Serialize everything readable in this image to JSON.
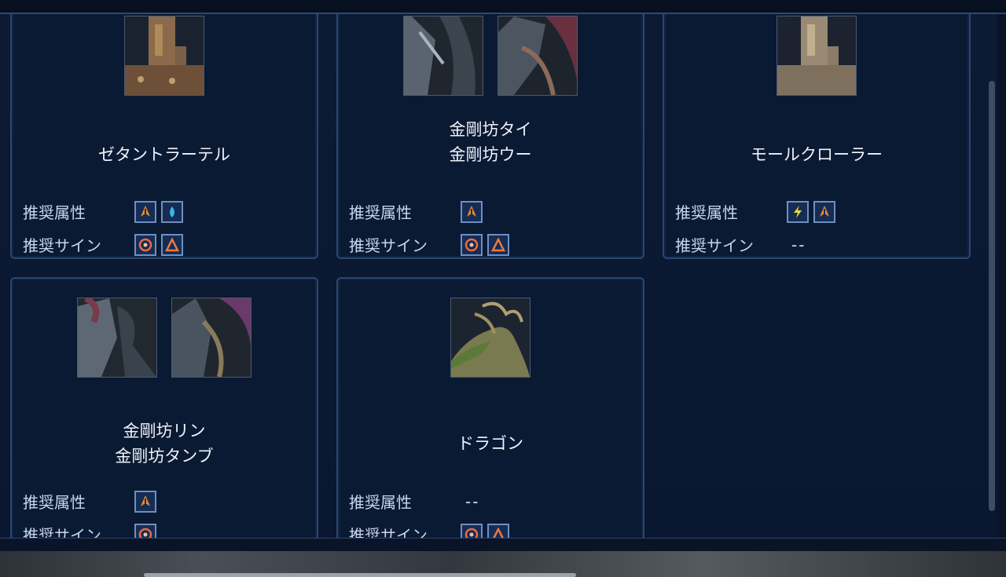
{
  "labels": {
    "attribute": "推奨属性",
    "sign": "推奨サイン",
    "none": "--"
  },
  "colors": {
    "panel": "#0b1a33",
    "border": "#2a4670",
    "fire": "#f08a2c",
    "water": "#3cb6e8",
    "thunder": "#e8d83a"
  },
  "cards": [
    {
      "names": [
        "ゼタントラーテル"
      ],
      "portraits": [
        "machine-tower"
      ],
      "attributes": [
        "fire-icon",
        "water-icon"
      ],
      "signs": [
        "target-sign-icon",
        "triangle-sign-icon"
      ]
    },
    {
      "names": [
        "金剛坊タイ",
        "金剛坊ウー"
      ],
      "portraits": [
        "insect-boss",
        "insect-boss"
      ],
      "attributes": [
        "fire-icon"
      ],
      "signs": [
        "target-sign-icon",
        "triangle-sign-icon"
      ]
    },
    {
      "names": [
        "モールクローラー"
      ],
      "portraits": [
        "machine-tower"
      ],
      "attributes": [
        "thunder-icon",
        "fire-icon"
      ],
      "signs": []
    },
    {
      "names": [
        "金剛坊リン",
        "金剛坊タンブ"
      ],
      "portraits": [
        "insect-boss",
        "insect-boss"
      ],
      "attributes": [
        "fire-icon"
      ],
      "signs": [
        "target-sign-icon"
      ]
    },
    {
      "names": [
        "ドラゴン"
      ],
      "portraits": [
        "dragon"
      ],
      "attributes": [],
      "signs": [
        "target-sign-icon",
        "triangle-sign-icon"
      ]
    }
  ]
}
